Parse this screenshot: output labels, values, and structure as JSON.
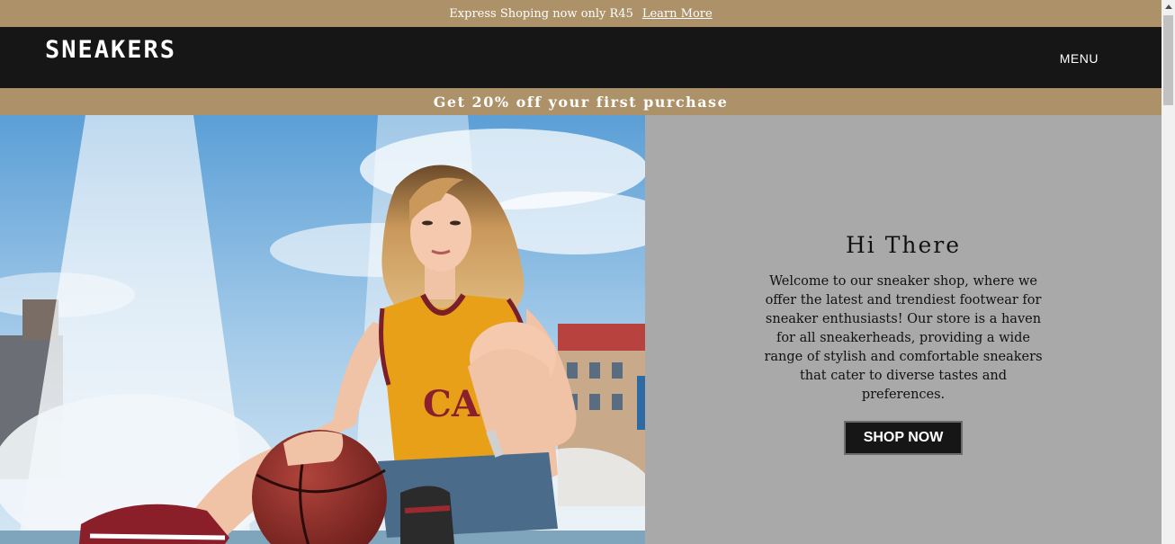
{
  "announcement": {
    "text": "Express Shoping now only R45",
    "link": "Learn More"
  },
  "header": {
    "logo": "SNEAKERS",
    "menu": "MENU"
  },
  "promo": {
    "text": "Get 20% off your first purchase"
  },
  "hero": {
    "title": "Hi There",
    "body": "Welcome to our sneaker shop, where we offer the latest and trendiest footwear for sneaker enthusiasts! Our store is a haven for all sneakerheads, providing a wide range of stylish and comfortable sneakers that cater to diverse tastes and preferences.",
    "cta": "SHOP NOW"
  },
  "colors": {
    "accent": "#ad9169",
    "header_bg": "#161616",
    "panel_bg": "#a9a9a9"
  }
}
